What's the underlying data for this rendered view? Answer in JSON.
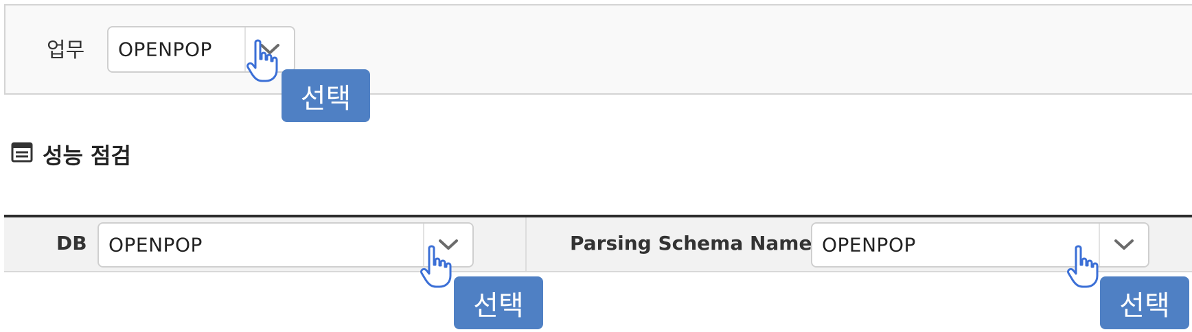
{
  "filter": {
    "business_label": "업무",
    "business_value": "OPENPOP"
  },
  "section": {
    "title": "성능 점검",
    "icon": "calendar-list-icon"
  },
  "table": {
    "db_label": "DB",
    "db_value": "OPENPOP",
    "schema_label": "Parsing Schema Name",
    "schema_value": "OPENPOP"
  },
  "annotations": {
    "select_badge_1": "선택",
    "select_badge_2": "선택",
    "select_badge_3": "선택"
  },
  "colors": {
    "badge_bg": "#4f80c4",
    "cursor": "#3b6fd6",
    "table_border_top": "#2b2b2b"
  }
}
